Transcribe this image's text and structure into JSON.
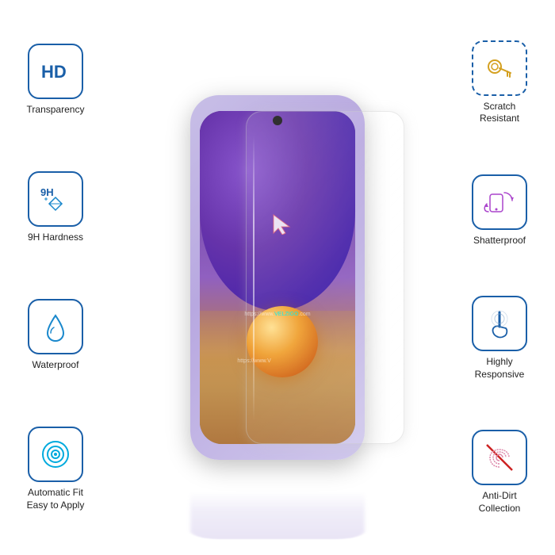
{
  "features": {
    "left": [
      {
        "id": "hd-transparency",
        "label": "Transparency",
        "icon": "hd"
      },
      {
        "id": "9h-hardness",
        "label": "9H Hardness",
        "icon": "diamond"
      },
      {
        "id": "waterproof",
        "label": "Waterproof",
        "icon": "drop"
      },
      {
        "id": "autofit",
        "label": "Automatic Fit\nEasy to Apply",
        "label1": "Automatic Fit",
        "label2": "Easy to Apply",
        "icon": "target"
      }
    ],
    "right": [
      {
        "id": "scratch-resistant",
        "label1": "Scratch",
        "label2": "Resistant",
        "icon": "key"
      },
      {
        "id": "shatterproof",
        "label": "Shatterproof",
        "icon": "phone-rotate"
      },
      {
        "id": "highly-responsive",
        "label1": "Highly",
        "label2": "Responsive",
        "icon": "touch"
      },
      {
        "id": "anti-dirt",
        "label1": "Anti-Dirt",
        "label2": "Collection",
        "icon": "fingerprint"
      }
    ]
  },
  "watermark": "https://www.VELZIGO.com",
  "watermark2": "https://www.V",
  "brand": {
    "name": "VELZIGO",
    "color": "#00dddd"
  },
  "colors": {
    "border": "#1a5fa8",
    "text": "#222222",
    "accent": "#00aadd"
  }
}
